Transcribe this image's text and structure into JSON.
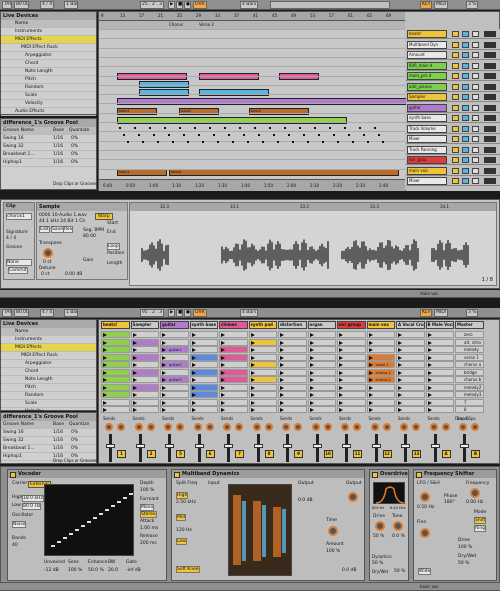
{
  "top": {
    "transport": {
      "tap": "TAP",
      "tempo": "80.00",
      "meter": "4 / 4",
      "pos": "25 . 2 . 3",
      "quant": "1 Bar",
      "ovr": "OVR",
      "bars": "4 Bars",
      "key": "KEY",
      "midi": "MIDI",
      "pct": "3 %"
    },
    "browser": {
      "title": "Live Devices",
      "name_hdr": "Name",
      "items": [
        "Instruments",
        "MIDI Effects",
        "MIDI Effect Rack",
        "Arpeggiator",
        "Chord",
        "Note Length",
        "Pitch",
        "Random",
        "Scale",
        "Velocity",
        "Audio Effects"
      ]
    },
    "groove": {
      "title": "difference_1's Groove Pool",
      "cols": [
        "Groove Name",
        "Base",
        "Quantize",
        "Ti"
      ],
      "rows": [
        {
          "name": "Swing 16",
          "base": "1/16",
          "q": "0%"
        },
        {
          "name": "Swing 32",
          "base": "1/16",
          "q": "0%"
        },
        {
          "name": "Breakbeat 1...",
          "base": "1/16",
          "q": "0%"
        },
        {
          "name": "Hiphop1",
          "base": "1/16",
          "q": "0%"
        }
      ],
      "drop": "Drop Clips or Grooves"
    },
    "ruler": [
      "9",
      "13",
      "17",
      "21",
      "25",
      "29",
      "33",
      "37",
      "41",
      "45",
      "49",
      "53",
      "57",
      "61",
      "65",
      "69"
    ],
    "locators": [
      "Chorus",
      "Verse 2"
    ],
    "tracks": [
      {
        "name": "beats!",
        "color": "#f0c43a"
      },
      {
        "name": "Multiband Dyn",
        "color": "#e8e8e8"
      },
      {
        "name": "Amount",
        "color": "#e8e8e8"
      },
      {
        "name": "606_main d",
        "color": "#7ad14c"
      },
      {
        "name": "main_pro d",
        "color": "#7ad14c"
      },
      {
        "name": "add_pianos",
        "color": "#7ad14c"
      },
      {
        "name": "Sampler",
        "color": "#f0c43a"
      },
      {
        "name": "guitar",
        "color": "#b07ad1"
      },
      {
        "name": "synth base",
        "color": "#e8e8e8"
      },
      {
        "name": "Track Volume",
        "color": "#e8e8e8"
      },
      {
        "name": "Mixer",
        "color": "#e8e8e8"
      },
      {
        "name": "Track Panning",
        "color": "#e8e8e8"
      },
      {
        "name": "ovr_grou",
        "color": "#e23a3a"
      },
      {
        "name": "main voic",
        "color": "#f0c43a"
      },
      {
        "name": "Mixer",
        "color": "#e8e8e8"
      }
    ],
    "clip_labels": [
      "bass1",
      "bass2",
      "bass3",
      "bass1",
      "bass5"
    ],
    "timebar": [
      "0:40",
      "0:50",
      "1:00",
      "1:10",
      "1:20",
      "1:30",
      "1:40",
      "1:50",
      "2:00",
      "2:10",
      "2:20",
      "2:30",
      "2:40"
    ],
    "sample_ruler": [
      "32.3",
      "33.1",
      "33.2",
      "33.3",
      "34.1"
    ],
    "clip_view": {
      "clip": "Clip",
      "sample": "Sample",
      "name": "chorus1",
      "sig": "Signature",
      "sig_val": "4 / 4",
      "groove": "Groove",
      "groove_val": "None",
      "commit": "Commit",
      "file": "0000 10-Audio 1.wav",
      "info": "44.1 kHz 24 Bit 1 Ch",
      "edit": "Edit",
      "save": "Save",
      "rev": "Rev",
      "warp": "Warp",
      "seg": "Seg. BPM",
      "bpm": "80.00",
      "start": "Start",
      "end": "End",
      "loop": "Loop",
      "position": "Position",
      "length": "Length",
      "transpose": "Transpose",
      "detune": "Detune",
      "st": "0 st",
      "ct": "0 ct",
      "db": "0.00 dB",
      "gain": "Gain",
      "page": "1 / 8"
    },
    "footer_track": "main voc"
  },
  "bottom": {
    "transport": {
      "tap": "TAP",
      "tempo": "80.00",
      "meter": "4 / 4",
      "pos": "95 . 2 . 3",
      "quant": "1 Bar",
      "ovr": "OVR",
      "bars": "4 Bars",
      "key": "KEY",
      "midi": "MIDI",
      "pct": "3 %"
    },
    "browser": {
      "title": "Live Devices",
      "name_hdr": "Name",
      "items": [
        "Instruments",
        "MIDI Effects",
        "MIDI Effect Rack",
        "Arpeggiator",
        "Chord",
        "Note Length",
        "Pitch",
        "Random",
        "Scale",
        "Velocity",
        "Audio Effects"
      ]
    },
    "groove": {
      "title": "difference_1's Groove Pool",
      "cols": [
        "Groove Name",
        "Base",
        "Quantize",
        "Ti"
      ],
      "rows": [
        {
          "name": "Swing 16",
          "base": "1/16",
          "q": "0%"
        },
        {
          "name": "Swing 32",
          "base": "1/16",
          "q": "0%"
        },
        {
          "name": "Breakbeat 1...",
          "base": "1/16",
          "q": "0%"
        },
        {
          "name": "Hiphop1",
          "base": "1/16",
          "q": "0%"
        }
      ],
      "drop": "Drop Clips or Grooves"
    },
    "session_tracks": [
      {
        "name": "beats!",
        "color": "#f0c43a"
      },
      {
        "name": "Sampler",
        "color": "#c9c9c9"
      },
      {
        "name": "guitar",
        "color": "#b07ad1"
      },
      {
        "name": "synth base",
        "color": "#c9c9c9"
      },
      {
        "name": "chimes",
        "color": "#e05a9a"
      },
      {
        "name": "synth pad",
        "color": "#f0c43a"
      },
      {
        "name": "distortion",
        "color": "#c9c9c9"
      },
      {
        "name": "organ",
        "color": "#c9c9c9"
      },
      {
        "name": "ovr group",
        "color": "#e23a3a"
      },
      {
        "name": "main vox",
        "color": "#f0c43a"
      },
      {
        "name": "A Vocal Crun",
        "color": "#c9c9c9"
      },
      {
        "name": "B Male Vocal",
        "color": "#c9c9c9"
      },
      {
        "name": "Master",
        "color": "#c9c9c9"
      }
    ],
    "clip_names": [
      "guitar1",
      "guitar2",
      "guitar3"
    ],
    "vox_clips": [
      "verse 1",
      "chorus 1",
      "chorus 2"
    ],
    "scenes": [
      "zero",
      "alt. intro",
      "melody",
      "verse 1",
      "chorus a",
      "bridge",
      "chorus b",
      "melody2",
      "melody3",
      "7",
      "8"
    ],
    "drop": "Drop Clips",
    "sends": "Sends",
    "track_nums": [
      "1",
      "2",
      "5",
      "6",
      "7",
      "8",
      "9",
      "10",
      "11",
      "12",
      "13",
      "A",
      "B"
    ],
    "devices": [
      {
        "name": "Vocoder",
        "labels": [
          "Carrier",
          "External",
          "High",
          "Low",
          "Oscillator",
          "Noise",
          "Depth",
          "Release",
          "Formant",
          "Mono",
          "Stereo",
          "Attack",
          "Bands",
          "Range"
        ],
        "values": [
          "40",
          "18.0 kHz",
          "80.0 Hz",
          "0.0",
          "100 %",
          "200 ms",
          "1.00 ms",
          "40"
        ],
        "bottom": [
          "Unvoiced",
          "Sens",
          "Enhance",
          "BW",
          "Gate"
        ],
        "bottom_vals": [
          "-12 dB",
          "100 %",
          "50.0 %",
          "20.0",
          "-inf dB"
        ]
      },
      {
        "name": "Multiband Dynamics",
        "labels": [
          "Split Freq",
          "High",
          "Mid",
          "Low",
          "Soft Knee",
          "Input",
          "Output",
          "Below",
          "Above",
          "Time",
          "Amount",
          "Output"
        ],
        "values": [
          "2.50 kHz",
          "2.80 kHz",
          "120 Hz",
          "0.0 dB",
          "0.0 dB",
          "100 %",
          "0.0 dB"
        ]
      },
      {
        "name": "Overdrive",
        "labels": [
          "Drive",
          "Tone",
          "Dynamics",
          "Dry/Wet"
        ],
        "values": [
          "800 Hz",
          "6.40 kHz",
          "50 %",
          "0.0 %",
          "50 %",
          "50 %"
        ]
      },
      {
        "name": "Frequency Shifter",
        "labels": [
          "LFO / S&H",
          "Frequency",
          "Phase",
          "Mode",
          "Fine",
          "Drive",
          "Dry/Wet",
          "Shift",
          "Ring",
          "Wide"
        ],
        "values": [
          "0.50 Hz",
          "0.00 Hz",
          "180°",
          "100 %",
          "50 %"
        ]
      }
    ],
    "footer_track": "basic voc"
  }
}
